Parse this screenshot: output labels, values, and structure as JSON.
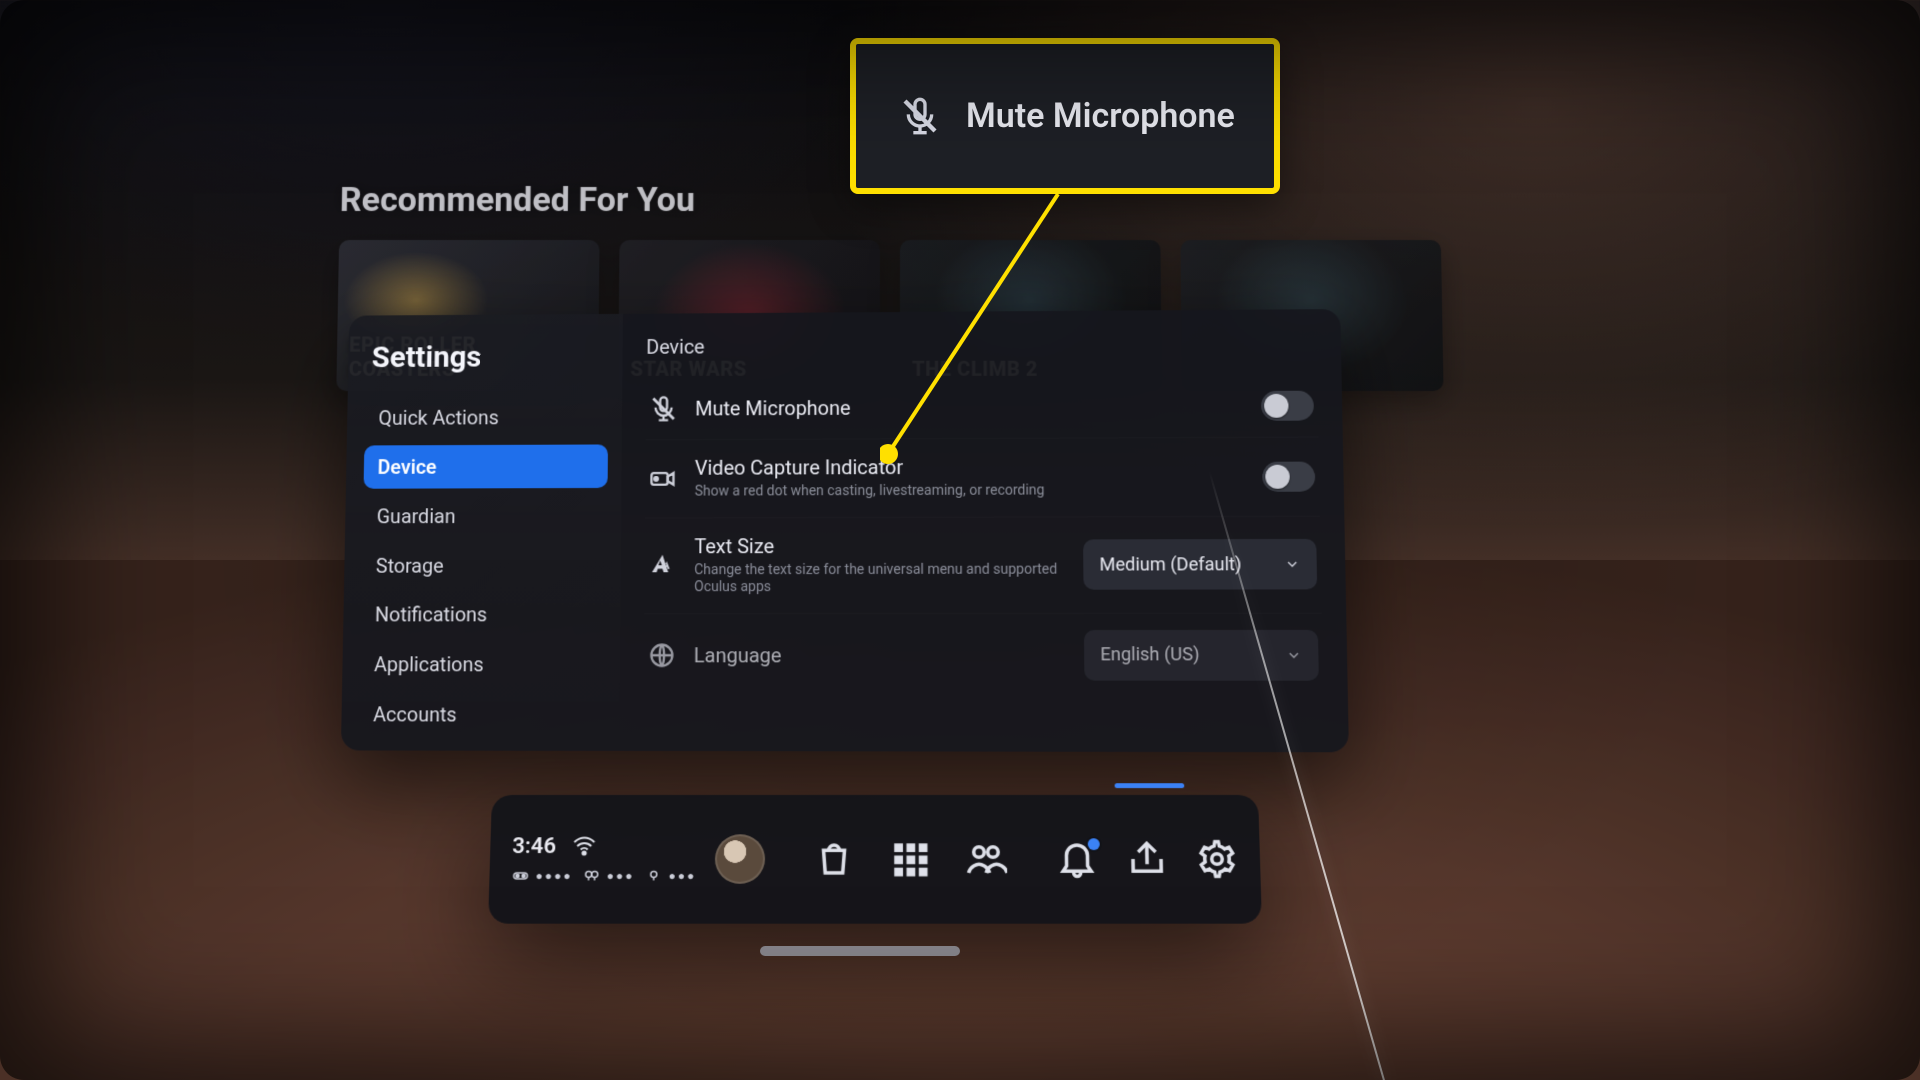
{
  "store": {
    "section_title": "Recommended For You",
    "cards": [
      {
        "title": "EPIC ROLLER COASTERS"
      },
      {
        "title": "STAR WARS"
      },
      {
        "title": "THE CLIMB 2"
      }
    ]
  },
  "callout": {
    "label": "Mute Microphone"
  },
  "settings": {
    "title": "Settings",
    "items": [
      {
        "label": "Quick Actions",
        "active": false
      },
      {
        "label": "Device",
        "active": true
      },
      {
        "label": "Guardian",
        "active": false
      },
      {
        "label": "Storage",
        "active": false
      },
      {
        "label": "Notifications",
        "active": false
      },
      {
        "label": "Applications",
        "active": false
      },
      {
        "label": "Accounts",
        "active": false
      }
    ],
    "content_header": "Device",
    "rows": {
      "mic": {
        "label": "Mute Microphone",
        "enabled": false
      },
      "video_indicator": {
        "label": "Video Capture Indicator",
        "desc": "Show a red dot when casting, livestreaming, or recording",
        "enabled": false
      },
      "text_size": {
        "label": "Text Size",
        "desc": "Change the text size for the universal menu and supported Oculus apps",
        "value": "Medium (Default)"
      },
      "language": {
        "label": "Language",
        "value": "English (US)"
      }
    }
  },
  "taskbar": {
    "time": "3:46",
    "battery_left": "●●●●",
    "battery_link": "●●●",
    "battery_right": "●●●"
  }
}
